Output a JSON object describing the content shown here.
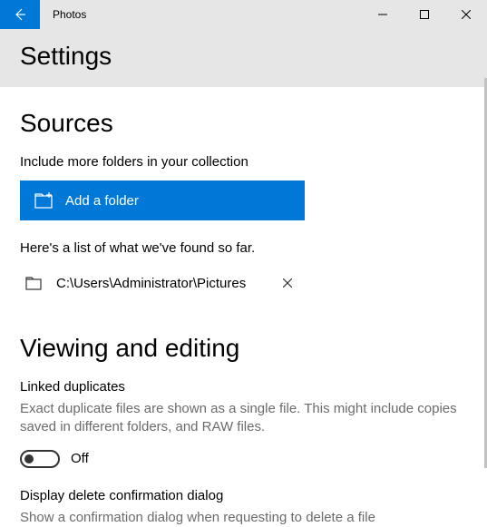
{
  "titlebar": {
    "app_name": "Photos"
  },
  "header": {
    "title": "Settings"
  },
  "sources": {
    "heading": "Sources",
    "include_text": "Include more folders in your collection",
    "add_button_label": "Add a folder",
    "found_text": "Here's a list of what we've found so far.",
    "folder_path": "C:\\Users\\Administrator\\Pictures"
  },
  "viewing": {
    "heading": "Viewing and editing",
    "linked_heading": "Linked duplicates",
    "linked_desc": "Exact duplicate files are shown as a single file. This might include copies saved in different folders, and RAW files.",
    "toggle_state": "Off",
    "delete_heading": "Display delete confirmation dialog",
    "delete_desc": "Show a confirmation dialog when requesting to delete a file"
  }
}
